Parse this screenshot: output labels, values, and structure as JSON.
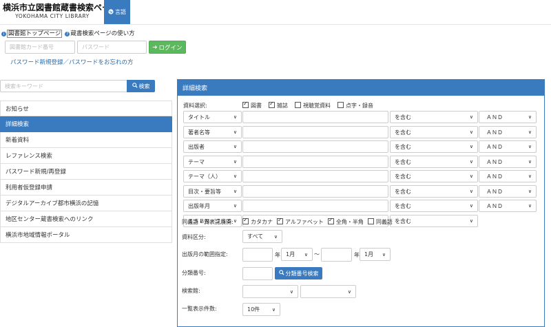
{
  "header": {
    "title": "横浜市立図書館蔵書検索ページ",
    "subtitle": "YOKOHAMA CITY LIBRARY",
    "language_button": "言語"
  },
  "top_links": {
    "library_top": "図書館トップページ",
    "how_to_use": "蔵書検索ページの使い方"
  },
  "login": {
    "card_placeholder": "図書館カード番号",
    "password_placeholder": "パスワード",
    "login_button": "ログイン",
    "password_link": "パスワード新規登録／パスワードをお忘れの方"
  },
  "sidebar": {
    "search_placeholder": "検索キーワード",
    "search_button": "検索",
    "items": [
      {
        "label": "お知らせ",
        "active": false
      },
      {
        "label": "詳細検索",
        "active": true
      },
      {
        "label": "新着資料",
        "active": false
      },
      {
        "label": "レファレンス検索",
        "active": false
      },
      {
        "label": "パスワード新規/再登録",
        "active": false
      },
      {
        "label": "利用者仮登録申請",
        "active": false
      },
      {
        "label": "デジタルアーカイブ都市横浜の記憶",
        "active": false
      },
      {
        "label": "地区センター蔵書検索へのリンク",
        "active": false
      },
      {
        "label": "横浜市地域情報ポータル",
        "active": false
      }
    ]
  },
  "advanced_search": {
    "title": "詳細検索",
    "material_label": "資料選択:",
    "material_types": [
      {
        "label": "図書",
        "checked": true
      },
      {
        "label": "雑誌",
        "checked": true
      },
      {
        "label": "視聴覚資料",
        "checked": false
      },
      {
        "label": "点字・録音",
        "checked": false
      }
    ],
    "rows": [
      {
        "field": "タイトル",
        "match": "を含む",
        "op": "ＡＮＤ"
      },
      {
        "field": "著者名等",
        "match": "を含む",
        "op": "ＡＮＤ"
      },
      {
        "field": "出版者",
        "match": "を含む",
        "op": "ＡＮＤ"
      },
      {
        "field": "テーマ",
        "match": "を含む",
        "op": "ＡＮＤ"
      },
      {
        "field": "テーマ（人）",
        "match": "を含む",
        "op": "ＡＮＤ"
      },
      {
        "field": "目次・要旨等",
        "match": "を含む",
        "op": "ＡＮＤ"
      },
      {
        "field": "出版年月",
        "match": "を含む",
        "op": "ＡＮＤ"
      },
      {
        "field": "ＩＳＢＮ／ＩＳＳ",
        "match": "を含む",
        "op": ""
      }
    ],
    "synonym_label": "同義語・異表記展開:",
    "synonym_options": [
      {
        "label": "カタカナ",
        "checked": true
      },
      {
        "label": "アルファベット",
        "checked": true
      },
      {
        "label": "全角・半角",
        "checked": true
      },
      {
        "label": "同義語",
        "checked": false
      }
    ],
    "category_label": "資料区分:",
    "category_value": "すべて",
    "date_range_label": "出版月の範囲指定:",
    "year_unit": "年",
    "month_value": "1月",
    "tilde": "～",
    "classification_label": "分類番号:",
    "classification_button": "分類番号検索",
    "library_label": "検索館:",
    "display_count_label": "一覧表示件数:",
    "display_count_value": "10件"
  }
}
